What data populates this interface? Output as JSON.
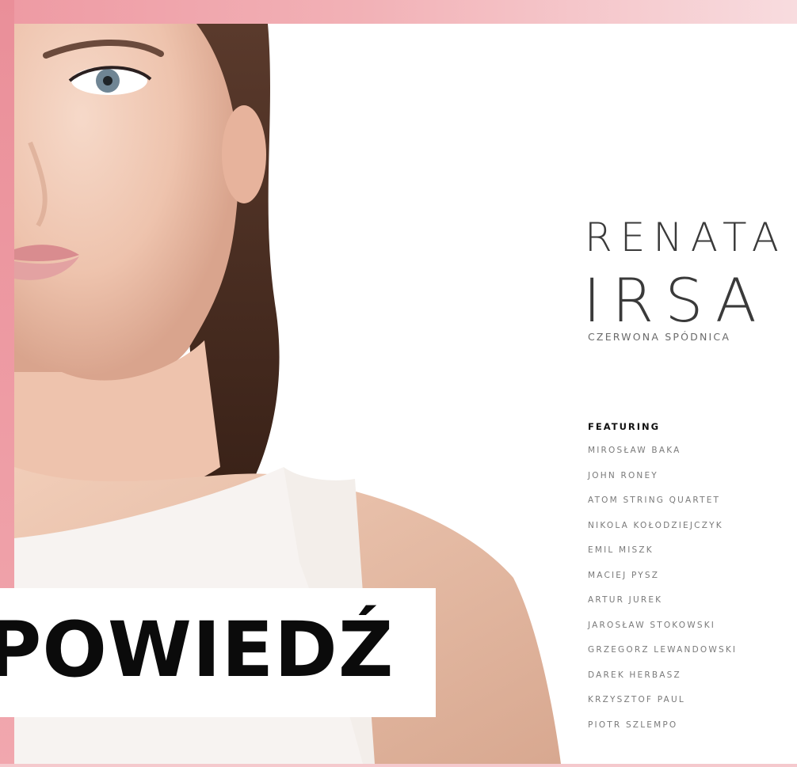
{
  "cover": {
    "artist_first_name": "RENATA",
    "artist_last_name": "IRSA",
    "album_title": "CZERWONA SPÓDNICA",
    "banner_word": "POWIEDŹ"
  },
  "featuring": {
    "heading": "FEATURING",
    "names": [
      "MIROSŁAW BAKA",
      "JOHN RONEY",
      "ATOM STRING QUARTET",
      "NIKOLA KOŁODZIEJCZYK",
      "EMIL MISZK",
      "MACIEJ PYSZ",
      "ARTUR JUREK",
      "JAROSŁAW STOKOWSKI",
      "GRZEGORZ LEWANDOWSKI",
      "DAREK HERBASZ",
      "KRZYSZTOF PAUL",
      "PIOTR SZLEMPO"
    ]
  },
  "colors": {
    "frame_pink": "#ee9aa3",
    "text_dark": "#3a3a3a",
    "text_light": "#7a7a7a",
    "banner_text": "#0b0b0b"
  }
}
